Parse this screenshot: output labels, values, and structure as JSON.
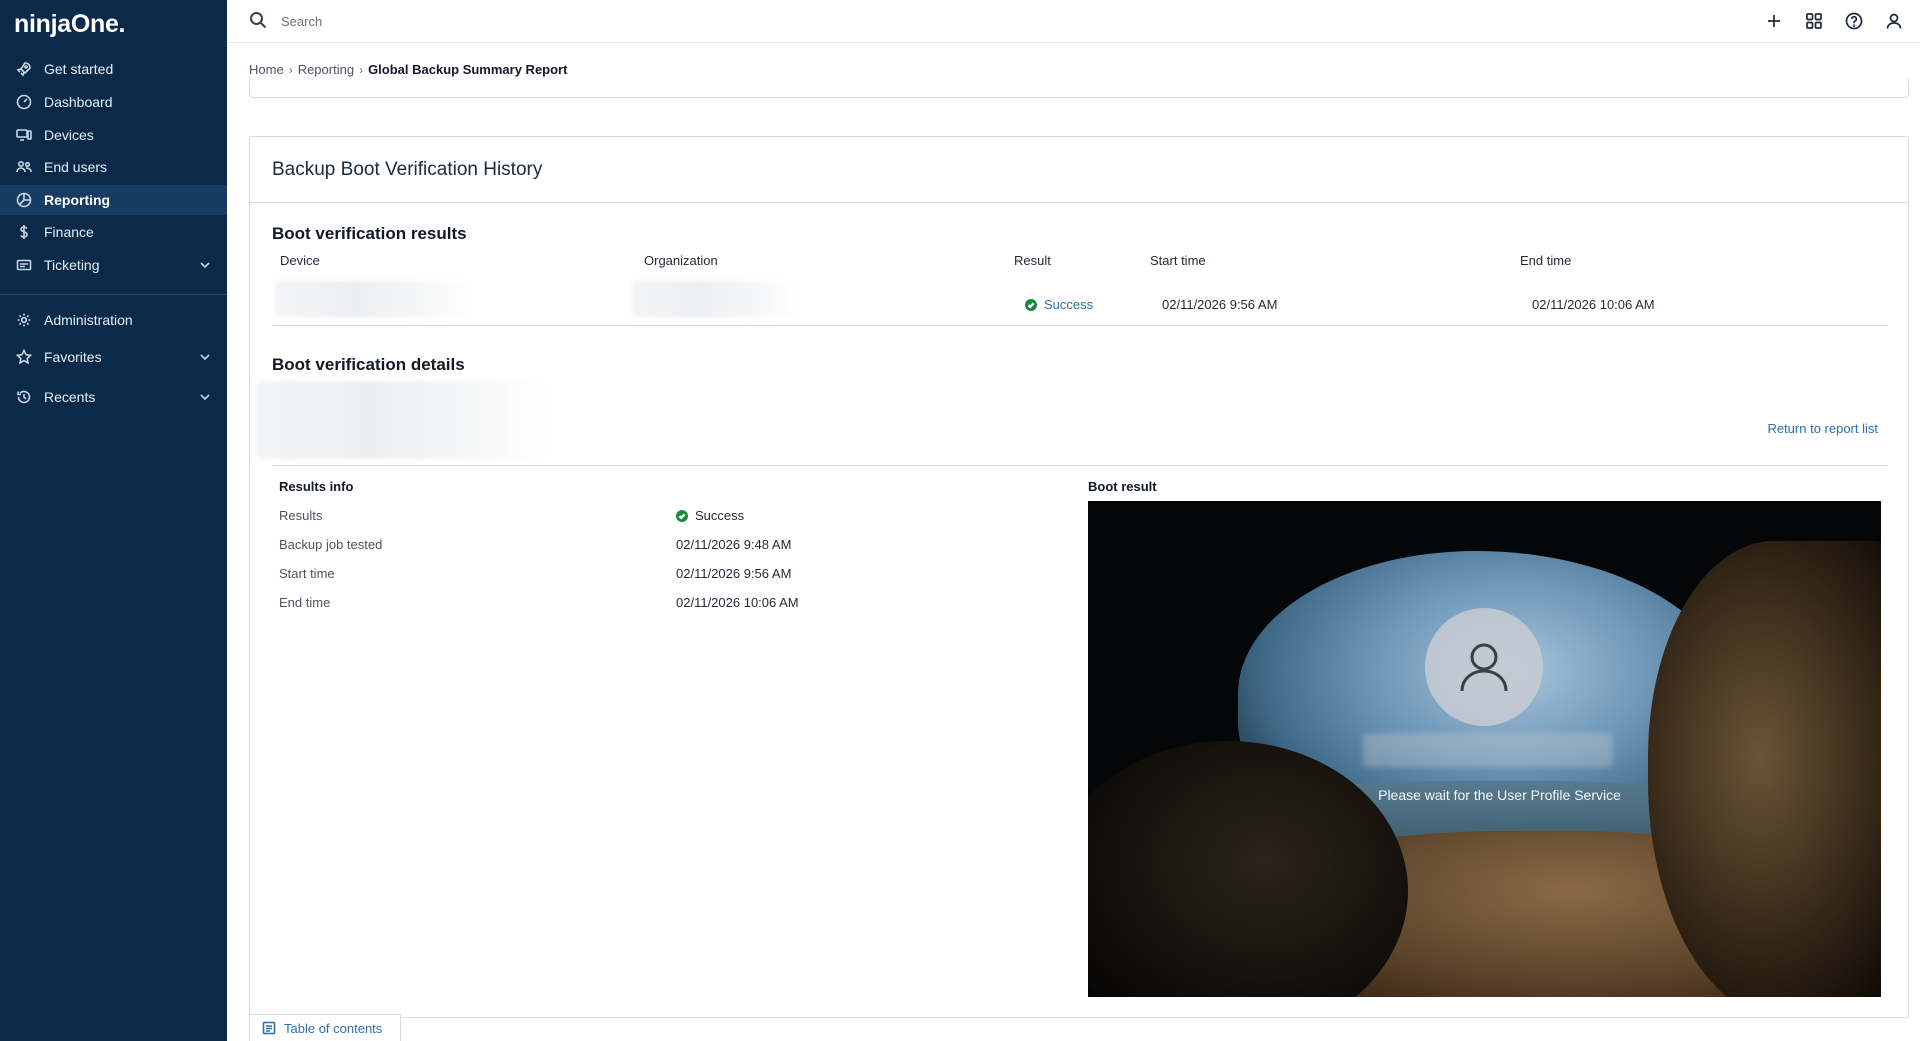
{
  "app": {
    "logo": "ninjaOne."
  },
  "sidebar": {
    "items": [
      {
        "label": "Get started",
        "icon": "rocket-icon"
      },
      {
        "label": "Dashboard",
        "icon": "gauge-icon"
      },
      {
        "label": "Devices",
        "icon": "devices-icon"
      },
      {
        "label": "End users",
        "icon": "users-icon"
      },
      {
        "label": "Reporting",
        "icon": "reporting-icon",
        "active": true
      },
      {
        "label": "Finance",
        "icon": "dollar-icon"
      },
      {
        "label": "Ticketing",
        "icon": "ticket-icon",
        "expandable": true
      },
      {
        "label": "Administration",
        "icon": "gear-icon"
      },
      {
        "label": "Favorites",
        "icon": "star-icon",
        "expandable": true
      },
      {
        "label": "Recents",
        "icon": "history-icon",
        "expandable": true
      }
    ]
  },
  "search": {
    "placeholder": "Search"
  },
  "topbar": {
    "icons": [
      "plus-icon",
      "apps-grid-icon",
      "help-icon",
      "user-icon"
    ]
  },
  "breadcrumb": {
    "home": "Home",
    "reporting": "Reporting",
    "current": "Global Backup Summary Report"
  },
  "report": {
    "title": "Backup Boot Verification History",
    "results_section": "Boot verification results",
    "columns": {
      "device": "Device",
      "organization": "Organization",
      "result": "Result",
      "start_time": "Start time",
      "end_time": "End time"
    },
    "row": {
      "result": "Success",
      "start_time": "02/11/2026 9:56 AM",
      "end_time": "02/11/2026 10:06 AM"
    },
    "details_section": "Boot verification details",
    "return_link": "Return to report list",
    "results_info": {
      "heading": "Results info",
      "rows": [
        {
          "label": "Results",
          "value": "Success"
        },
        {
          "label": "Backup job tested",
          "value": "02/11/2026 9:48 AM"
        },
        {
          "label": "Start time",
          "value": "02/11/2026 9:56 AM"
        },
        {
          "label": "End time",
          "value": "02/11/2026 10:06 AM"
        }
      ]
    },
    "boot_result": {
      "heading": "Boot result",
      "message": "Please wait for the User Profile Service"
    }
  },
  "toc": {
    "label": "Table of contents"
  },
  "colors": {
    "sidebar_bg": "#0b2a4a",
    "sidebar_active": "#163c63",
    "link": "#2f6ea8",
    "success": "#1a8a3a"
  }
}
